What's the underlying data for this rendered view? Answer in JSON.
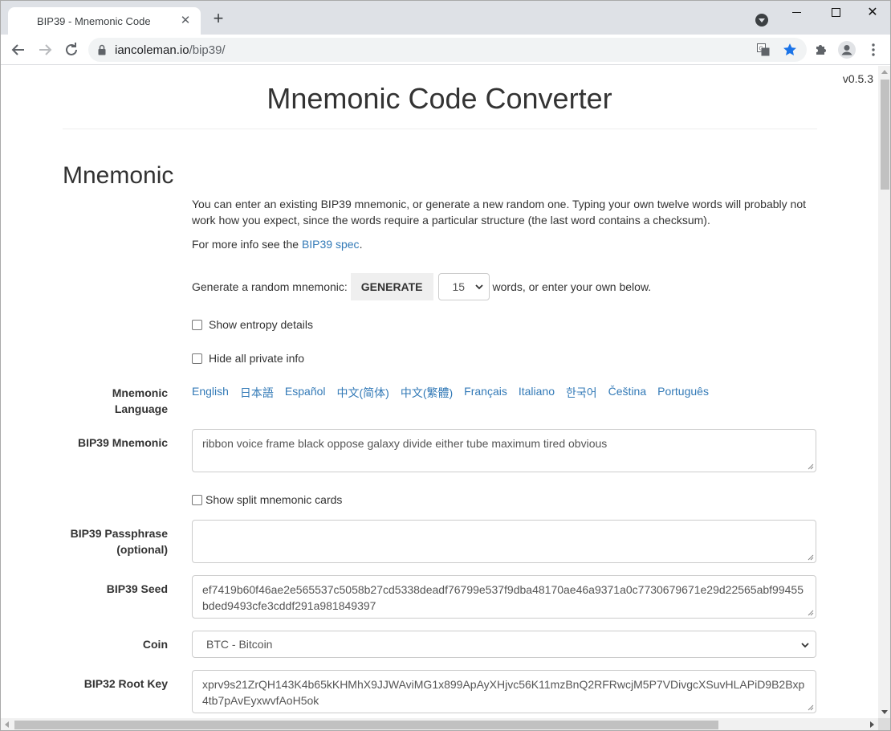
{
  "browser": {
    "tab_title": "BIP39 - Mnemonic Code",
    "url_domain": "iancoleman.io",
    "url_path": "/bip39/"
  },
  "page": {
    "version": "v0.5.3",
    "title": "Mnemonic Code Converter",
    "section_title": "Mnemonic",
    "intro_text": "You can enter an existing BIP39 mnemonic, or generate a new random one. Typing your own twelve words will probably not work how you expect, since the words require a particular structure (the last word contains a checksum).",
    "more_info_prefix": "For more info see the ",
    "more_info_link": "BIP39 spec",
    "more_info_suffix": ".",
    "generate_label": "Generate a random mnemonic:",
    "generate_button": "GENERATE",
    "words_value": "15",
    "generate_tail": "words, or enter your own below.",
    "show_entropy_label": "Show entropy details",
    "hide_private_label": "Hide all private info",
    "mnemonic_language_label_1": "Mnemonic",
    "mnemonic_language_label_2": "Language",
    "languages": [
      "English",
      "日本語",
      "Español",
      "中文(简体)",
      "中文(繁體)",
      "Français",
      "Italiano",
      "한국어",
      "Čeština",
      "Português"
    ],
    "bip39_mnemonic_label": "BIP39 Mnemonic",
    "bip39_mnemonic_value": "ribbon voice frame black oppose galaxy divide either tube maximum tired obvious",
    "split_cards_label": "Show split mnemonic cards",
    "passphrase_label_1": "BIP39 Passphrase",
    "passphrase_label_2": "(optional)",
    "passphrase_value": "",
    "seed_label": "BIP39 Seed",
    "seed_value": "ef7419b60f46ae2e565537c5058b27cd5338deadf76799e537f9dba48170ae46a9371a0c7730679671e29d22565abf99455bded9493cfe3cddf291a981849397",
    "coin_label": "Coin",
    "coin_value": "BTC - Bitcoin",
    "root_key_label": "BIP32 Root Key",
    "root_key_value": "xprv9s21ZrQH143K4b65kKHMhX9JJWAviMG1x899ApAyXHjvc56K11mzBnQ2RFRwcjM5P7VDivgcXSuvHLAPiD9B2Bxp4tb7pAvEyxwvfAoH5ok"
  },
  "colors": {
    "link": "#337ab7",
    "text": "#333333",
    "chrome_bg": "#dee1e6"
  }
}
